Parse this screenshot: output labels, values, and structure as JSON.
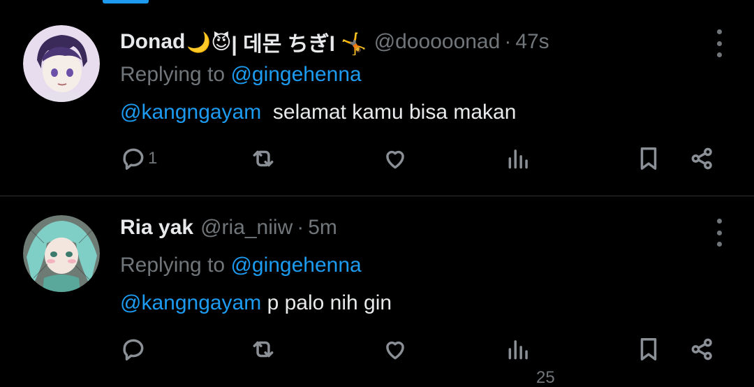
{
  "tweets": [
    {
      "display_name": "Donad",
      "name_emojis": "🌙😈",
      "name_suffix": " | 데몬 ちぎl 🤸",
      "handle": "@dooooonad",
      "time": "47s",
      "replying_prefix": "Replying to ",
      "replying_to": "@gingehenna",
      "mention": "@kangngayam",
      "text": "  selamat kamu bisa makan",
      "reply_count": "1"
    },
    {
      "display_name": "Ria yak",
      "handle": "@ria_niiw",
      "time": "5m",
      "replying_prefix": "Replying to ",
      "replying_to": "@gingehenna",
      "mention": "@kangngayam",
      "text": " p palo nih gin",
      "views_count": "25"
    }
  ],
  "icons": {
    "reply": "reply-icon",
    "repost": "repost-icon",
    "like": "heart-icon",
    "views": "views-icon",
    "bookmark": "bookmark-icon",
    "share": "share-icon",
    "more": "more-icon"
  },
  "colors": {
    "background": "#000000",
    "accent": "#1d9bf0",
    "muted": "#71767b",
    "text": "#e7e9ea"
  }
}
